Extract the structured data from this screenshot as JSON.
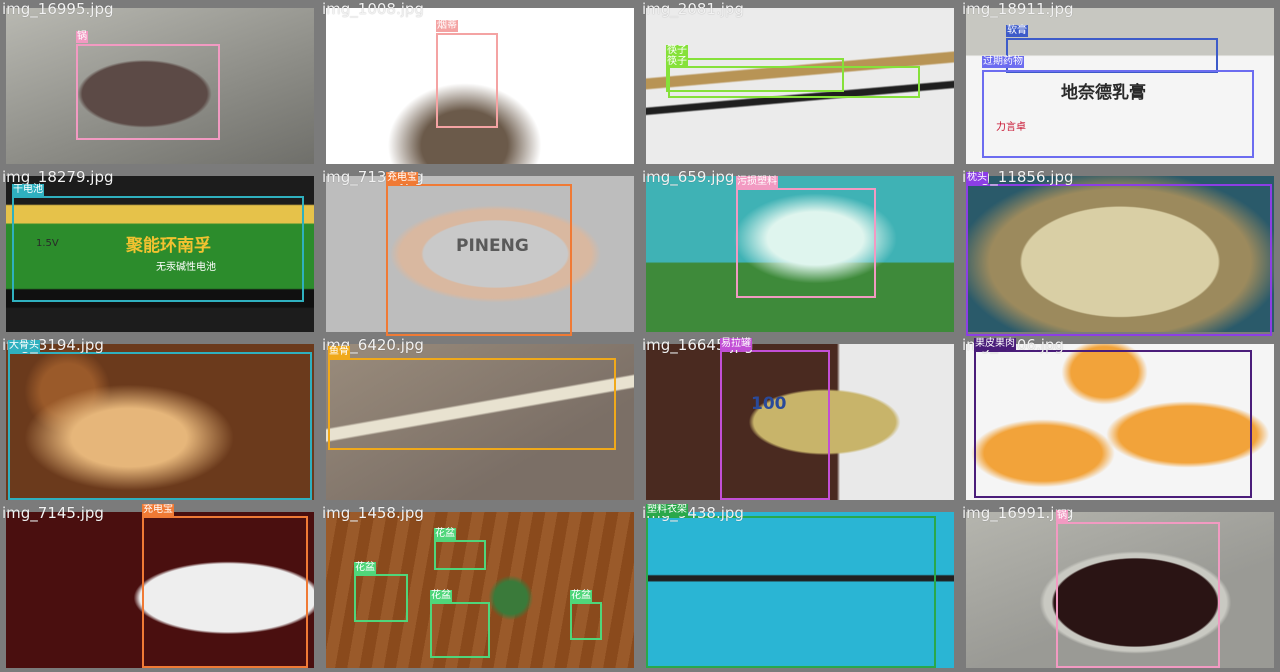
{
  "cells": [
    {
      "filename": "img_16995.jpg",
      "detections": [
        {
          "label": "锅",
          "color": "#f29ac2"
        }
      ],
      "palette": {
        "bg": "#8c8c86",
        "obj": "#5c4a46"
      }
    },
    {
      "filename": "img_1008.jpg",
      "detections": [
        {
          "label": "烟蒂",
          "color": "#f4a3a3"
        }
      ],
      "palette": {
        "bg": "#ffffff",
        "obj": "#d9863a"
      }
    },
    {
      "filename": "img_2081.jpg",
      "detections": [
        {
          "label": "筷子",
          "color": "#86e13a"
        },
        {
          "label": "筷子",
          "color": "#86e13a"
        }
      ],
      "palette": {
        "bg": "#ebebeb",
        "obj": "#b89455"
      }
    },
    {
      "filename": "img_18911.jpg",
      "detections": [
        {
          "label": "软膏",
          "color": "#3d5bc9"
        },
        {
          "label": "过期药物",
          "color": "#6c6cf0"
        }
      ],
      "palette": {
        "bg": "#c7c7c1",
        "obj": "#f5f5f5"
      },
      "product_text": [
        "地奈德乳膏",
        "力言卓"
      ]
    },
    {
      "filename": "img_18279.jpg",
      "detections": [
        {
          "label": "干电池",
          "color": "#2fb0bf"
        }
      ],
      "palette": {
        "bg": "#1c1c1c",
        "obj": "#2c8c2c"
      },
      "product_text": [
        "聚能环南孚",
        "1.5V",
        "无汞碱性电池"
      ]
    },
    {
      "filename": "img_7136.jpg",
      "detections": [
        {
          "label": "充电宝",
          "color": "#f07a35"
        }
      ],
      "palette": {
        "bg": "#bdbdbd",
        "obj": "#c9c9c9"
      },
      "product_text": [
        "PINENG"
      ]
    },
    {
      "filename": "img_659.jpg",
      "detections": [
        {
          "label": "污损塑料",
          "color": "#f29ac2"
        }
      ],
      "palette": {
        "bg": "#3fb2b5",
        "obj": "#dff5ee"
      }
    },
    {
      "filename": "img_11856.jpg",
      "detections": [
        {
          "label": "枕头",
          "color": "#8c3ee5"
        }
      ],
      "palette": {
        "bg": "#b9ad8b",
        "obj": "#d9cfa5"
      }
    },
    {
      "filename": "img_3194.jpg",
      "detections": [
        {
          "label": "大骨头",
          "color": "#2fb0bf"
        }
      ],
      "palette": {
        "bg": "#6b3a1c",
        "obj": "#e6b67a"
      }
    },
    {
      "filename": "img_6420.jpg",
      "detections": [
        {
          "label": "鱼骨",
          "color": "#f0a91a"
        }
      ],
      "palette": {
        "bg": "#7b6f66",
        "obj": "#e8e2d0"
      }
    },
    {
      "filename": "img_16645.jpg",
      "detections": [
        {
          "label": "易拉罐",
          "color": "#c24fd6"
        }
      ],
      "palette": {
        "bg": "#4a2a20",
        "obj": "#c8b46a"
      },
      "product_text": [
        "100"
      ]
    },
    {
      "filename": "img_1306.jpg",
      "detections": [
        {
          "label": "果皮果肉",
          "color": "#4a1d7a"
        }
      ],
      "palette": {
        "bg": "#f5f5f5",
        "obj": "#f2a33a"
      }
    },
    {
      "filename": "img_7145.jpg",
      "detections": [
        {
          "label": "充电宝",
          "color": "#f07a35"
        }
      ],
      "palette": {
        "bg": "#4a0f0f",
        "obj": "#eeeeee"
      }
    },
    {
      "filename": "img_1458.jpg",
      "detections": [
        {
          "label": "花盆",
          "color": "#4fd67a"
        },
        {
          "label": "花盆",
          "color": "#4fd67a"
        },
        {
          "label": "花盆",
          "color": "#4fd67a"
        },
        {
          "label": "花盆",
          "color": "#4fd67a"
        }
      ],
      "palette": {
        "bg": "#8a4a1c",
        "obj": "#2a2a2a"
      }
    },
    {
      "filename": "img_9438.jpg",
      "detections": [
        {
          "label": "塑料衣架",
          "color": "#2aa84a"
        }
      ],
      "palette": {
        "bg": "#2ab5d4",
        "obj": "#202020"
      }
    },
    {
      "filename": "img_16991.jpg",
      "detections": [
        {
          "label": "锅",
          "color": "#f29ac2"
        }
      ],
      "palette": {
        "bg": "#9a9a95",
        "obj": "#2a1414"
      }
    }
  ]
}
